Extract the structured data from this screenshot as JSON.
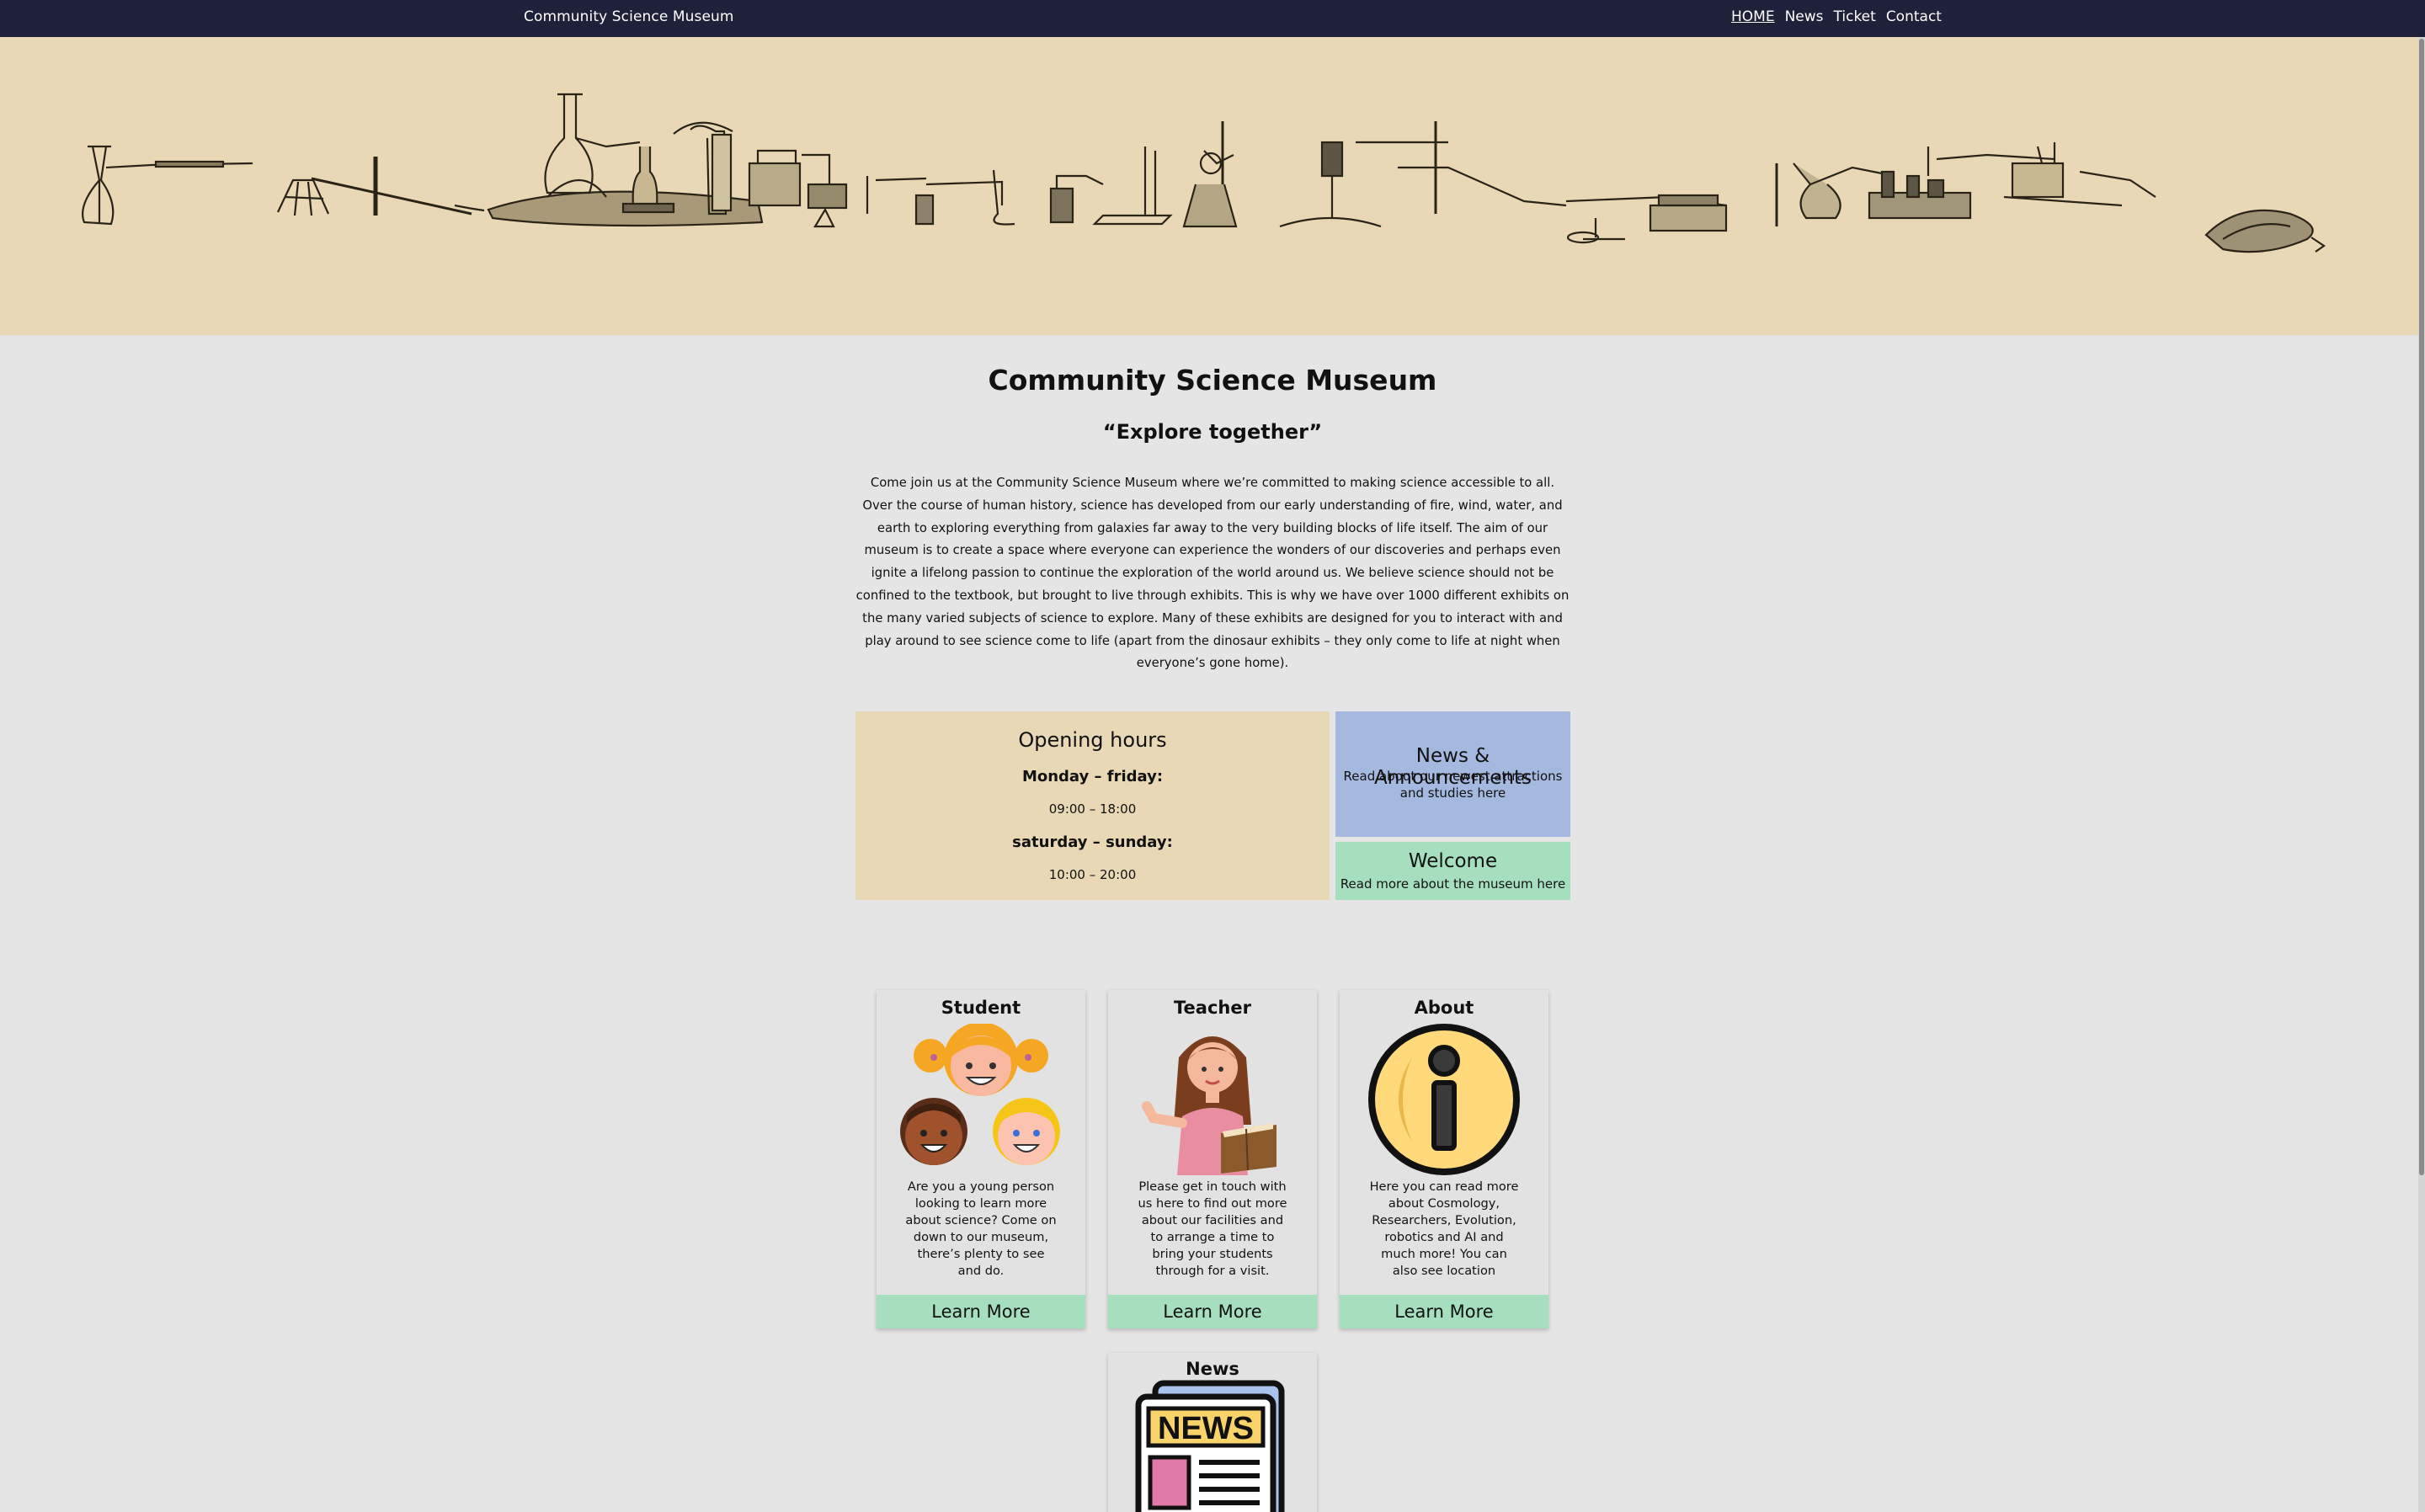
{
  "header": {
    "brand": "Community Science Museum",
    "nav": [
      "HOME",
      "News",
      "Ticket",
      "Contact"
    ]
  },
  "main": {
    "title": "Community Science Museum",
    "tagline": "“Explore together”",
    "intro": "Come join us at the Community Science Museum where we’re committed to making science accessible to all. Over the course of human history, science has developed from our early understanding of fire, wind, water, and earth to exploring everything from galaxies far away to the very building blocks of life itself. The aim of our museum is to create a space where everyone can experience the wonders of our discoveries and perhaps even ignite a lifelong passion to continue the exploration of the world around us. We believe science should not be confined to the textbook, but brought to live through exhibits. This is why we have over 1000 different exhibits on the many varied subjects of science to explore. Many of these exhibits are designed for you to interact with and play around to see science come to life (apart from the dinosaur exhibits – they only come to life at night when everyone’s gone home)."
  },
  "hours": {
    "title": "Opening hours",
    "weekday_label": "Monday – friday:",
    "weekday_time": "09:00 – 18:00",
    "weekend_label": "saturday – sunday:",
    "weekend_time": "10:00 – 20:00"
  },
  "news_box": {
    "title": "News & Announcements",
    "text": "Read about our newest attractions and studies here"
  },
  "welcome_box": {
    "title": "Welcome",
    "text": "Read more about the museum here"
  },
  "cards": [
    {
      "title": "Student",
      "icon": "children-icon",
      "text": "Are you a young person looking to learn more about science? Come on down to our museum, there’s plenty to see and do.",
      "button": "Learn More"
    },
    {
      "title": "Teacher",
      "icon": "teacher-icon",
      "text": "Please get in touch with us here to find out more about our facilities and to arrange a time to bring your students through for a visit.",
      "button": "Learn More"
    },
    {
      "title": "About",
      "icon": "info-icon",
      "text": "Here you can read more about Cosmology, Researchers, Evolution, robotics and AI and much more! You can also see location",
      "button": "Learn More"
    },
    {
      "title": "News",
      "icon": "newspaper-icon",
      "newspaper_text": "NEWS"
    }
  ],
  "colors": {
    "topbar": "#1e2139",
    "hero": "#e8d8b5",
    "news_box": "#a4b8e0",
    "welcome_box": "#a6dfbd",
    "page": "#e5e5e5"
  }
}
